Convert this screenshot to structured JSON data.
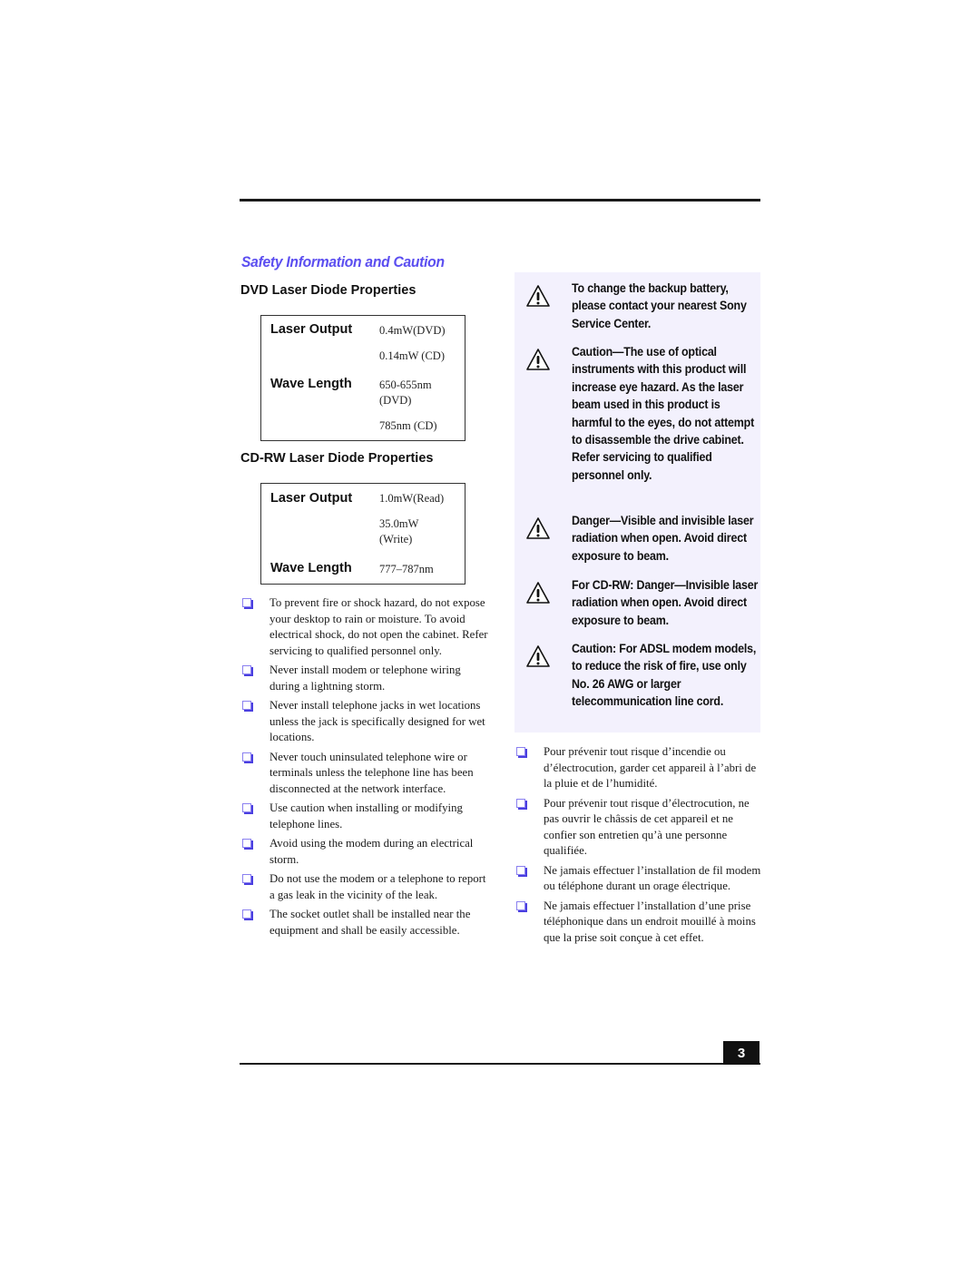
{
  "section_title": "Safety Information and Caution",
  "dvd": {
    "heading": "DVD Laser Diode Properties",
    "laser_output_label": "Laser Output",
    "laser_output_values": [
      "0.4mW(DVD)",
      "0.14mW (CD)"
    ],
    "wave_length_label": "Wave Length",
    "wave_length_values": [
      "650-655nm",
      "(DVD)",
      "785nm (CD)"
    ]
  },
  "cdrw": {
    "heading": "CD-RW Laser Diode Properties",
    "laser_output_label": "Laser Output",
    "laser_output_values": [
      "1.0mW(Read)",
      "35.0mW",
      "(Write)"
    ],
    "wave_length_label": "Wave Length",
    "wave_length_values": [
      "777–787nm"
    ]
  },
  "english_bullets": [
    "To prevent fire or shock hazard, do not expose your desktop to rain or moisture. To avoid electrical shock, do not open the cabinet. Refer servicing to qualified personnel only.",
    "Never install modem or telephone wiring during a lightning storm.",
    "Never install telephone jacks in wet locations unless the jack is specifically designed for wet locations.",
    "Never touch uninsulated telephone wire or terminals unless the telephone line has been disconnected at the network interface.",
    "Use caution when installing or modifying telephone lines.",
    "Avoid using the modem during an electrical storm.",
    "Do not use the modem or a telephone to report a gas leak in the vicinity of the leak.",
    "The socket outlet shall be installed near the equipment and shall be easily accessible."
  ],
  "cautions": [
    {
      "icon": "warning-triangle-icon",
      "text": "To change the backup battery, please contact your nearest Sony Service Center."
    },
    {
      "icon": "warning-triangle-icon",
      "text": "Caution—The use of optical instruments with this product will increase eye hazard. As the laser beam used in this product is harmful to the eyes, do not attempt to disassemble the drive cabinet. Refer servicing to qualified personnel only."
    },
    {
      "icon": "warning-triangle-icon",
      "text": "Danger—Visible and invisible laser radiation when open. Avoid direct exposure to beam."
    },
    {
      "icon": "warning-triangle-icon",
      "text": "For CD-RW: Danger—Invisible laser radiation when open. Avoid direct exposure to beam."
    },
    {
      "icon": "warning-triangle-icon",
      "text": "Caution: For ADSL modem models, to reduce the risk of fire, use only No. 26 AWG or larger telecommunication line cord."
    }
  ],
  "french_bullets": [
    "Pour prévenir tout risque d’incendie ou d’électrocution, garder cet appareil à l’abri de la pluie et de l’humidité.",
    "Pour prévenir tout risque d’électrocution, ne pas ouvrir le châssis de cet appareil et ne confier son entretien qu’à une personne qualifiée.",
    "Ne jamais effectuer l’installation de fil modem ou téléphone durant un orage électrique.",
    "Ne jamais effectuer l’installation d’une prise téléphonique dans un endroit mouillé à moins que la prise soit conçue à cet effet."
  ],
  "page_number": "3",
  "colors": {
    "title": "#5b4ef0",
    "caution_panel": "#f3f1fd",
    "bullet": "#4a3fe0"
  }
}
